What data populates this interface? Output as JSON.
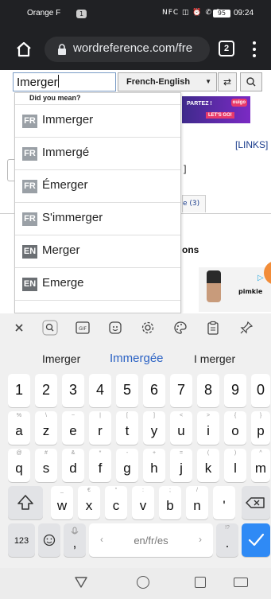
{
  "status_bar": {
    "carrier": "Orange F",
    "sim_badge": "1",
    "icons": "NFC ◫ ⏰ ✆ ⚲",
    "battery": "95",
    "time": "09:24"
  },
  "browser": {
    "url": "wordreference.com/fre",
    "tab_count": "2"
  },
  "search": {
    "query": "Imerger",
    "dictionary": "French-English"
  },
  "dropdown": {
    "heading": "Did you mean?",
    "suggestions": [
      {
        "lang": "FR",
        "word": "Immerger"
      },
      {
        "lang": "FR",
        "word": "Immergé"
      },
      {
        "lang": "FR",
        "word": "Émerger"
      },
      {
        "lang": "FR",
        "word": "S'immerger"
      },
      {
        "lang": "EN",
        "word": "Merger"
      },
      {
        "lang": "EN",
        "word": "Emerge"
      }
    ]
  },
  "background_page": {
    "ad_line1": "PARTEZ !",
    "ad_line2": "LET'S GO!",
    "ad_badge": "ouigo",
    "links": "[LINKS]",
    "bracket": "]",
    "tab_fragment": "e (3)",
    "heading_fragment": "ons",
    "ad_brand": "pimkie"
  },
  "keyboard": {
    "suggestions": [
      "Imerger",
      "Immergée",
      "I merger"
    ],
    "number_row": [
      "1",
      "2",
      "3",
      "4",
      "5",
      "6",
      "7",
      "8",
      "9",
      "0"
    ],
    "row1": [
      "a",
      "z",
      "e",
      "r",
      "t",
      "y",
      "u",
      "i",
      "o",
      "p"
    ],
    "row1_hints": [
      "%",
      "\\",
      "~",
      "|",
      "[",
      "]",
      "<",
      ">",
      "{",
      "}"
    ],
    "row2": [
      "q",
      "s",
      "d",
      "f",
      "g",
      "h",
      "j",
      "k",
      "l",
      "m"
    ],
    "row2_hints": [
      "@",
      "#",
      "&",
      "*",
      "-",
      "+",
      "=",
      "(",
      ")",
      "^"
    ],
    "row3": [
      "w",
      "x",
      "c",
      "v",
      "b",
      "n",
      "'"
    ],
    "row3_hints": [
      "_",
      "€",
      "\"",
      ":",
      ";",
      "/",
      ""
    ],
    "symbols_key": "123",
    "comma_key": ",",
    "space_label": "en/fr/es",
    "period_key": ".",
    "period_hint": "!?"
  },
  "colors": {
    "chrome_dark": "#202124",
    "accent_blue": "#2f8af5",
    "suggestion_blue": "#2b62c4"
  }
}
